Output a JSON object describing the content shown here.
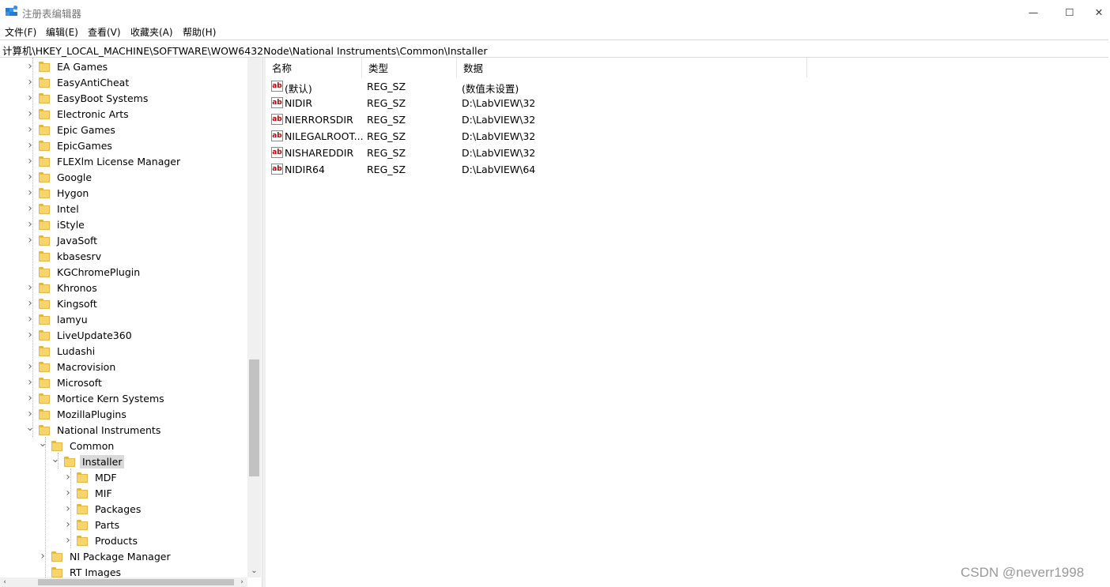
{
  "window": {
    "title": "注册表编辑器",
    "minimize_glyph": "—",
    "maximize_glyph": "☐",
    "close_glyph": "✕"
  },
  "menu": [
    "文件(F)",
    "编辑(E)",
    "查看(V)",
    "收藏夹(A)",
    "帮助(H)"
  ],
  "address": "计算机\\HKEY_LOCAL_MACHINE\\SOFTWARE\\WOW6432Node\\National Instruments\\Common\\Installer",
  "tree": {
    "items": [
      {
        "label": "EA Games",
        "expander": "collapsed"
      },
      {
        "label": "EasyAntiCheat",
        "expander": "collapsed"
      },
      {
        "label": "EasyBoot Systems",
        "expander": "collapsed"
      },
      {
        "label": "Electronic Arts",
        "expander": "collapsed"
      },
      {
        "label": "Epic Games",
        "expander": "collapsed"
      },
      {
        "label": "EpicGames",
        "expander": "collapsed"
      },
      {
        "label": "FLEXlm License Manager",
        "expander": "collapsed"
      },
      {
        "label": "Google",
        "expander": "collapsed"
      },
      {
        "label": "Hygon",
        "expander": "collapsed"
      },
      {
        "label": "Intel",
        "expander": "collapsed"
      },
      {
        "label": "iStyle",
        "expander": "collapsed"
      },
      {
        "label": "JavaSoft",
        "expander": "collapsed"
      },
      {
        "label": "kbasesrv",
        "expander": "none"
      },
      {
        "label": "KGChromePlugin",
        "expander": "none"
      },
      {
        "label": "Khronos",
        "expander": "collapsed"
      },
      {
        "label": "Kingsoft",
        "expander": "collapsed"
      },
      {
        "label": "lamyu",
        "expander": "collapsed"
      },
      {
        "label": "LiveUpdate360",
        "expander": "collapsed"
      },
      {
        "label": "Ludashi",
        "expander": "none"
      },
      {
        "label": "Macrovision",
        "expander": "collapsed"
      },
      {
        "label": "Microsoft",
        "expander": "collapsed"
      },
      {
        "label": "Mortice Kern Systems",
        "expander": "collapsed"
      },
      {
        "label": "MozillaPlugins",
        "expander": "collapsed"
      },
      {
        "label": "National Instruments",
        "expander": "expanded"
      },
      {
        "label": "Common",
        "expander": "expanded"
      },
      {
        "label": "Installer",
        "expander": "expanded",
        "selected": true
      },
      {
        "label": "MDF",
        "expander": "collapsed"
      },
      {
        "label": "MIF",
        "expander": "collapsed"
      },
      {
        "label": "Packages",
        "expander": "collapsed"
      },
      {
        "label": "Parts",
        "expander": "collapsed"
      },
      {
        "label": "Products",
        "expander": "collapsed"
      },
      {
        "label": "NI Package Manager",
        "expander": "collapsed"
      },
      {
        "label": "RT Images",
        "expander": "none"
      }
    ]
  },
  "columns": {
    "name": "名称",
    "type": "类型",
    "data": "数据"
  },
  "values": [
    {
      "icon": "ab",
      "name": "(默认)",
      "type": "REG_SZ",
      "data": "(数值未设置)"
    },
    {
      "icon": "ab",
      "name": "NIDIR",
      "type": "REG_SZ",
      "data": "D:\\LabVIEW\\32"
    },
    {
      "icon": "ab",
      "name": "NIERRORSDIR",
      "type": "REG_SZ",
      "data": "D:\\LabVIEW\\32"
    },
    {
      "icon": "ab",
      "name": "NILEGALROOT...",
      "type": "REG_SZ",
      "data": "D:\\LabVIEW\\32"
    },
    {
      "icon": "ab",
      "name": "NISHAREDDIR",
      "type": "REG_SZ",
      "data": "D:\\LabVIEW\\32"
    },
    {
      "icon": "ab",
      "name": "NIDIR64",
      "type": "REG_SZ",
      "data": "D:\\LabVIEW\\64"
    }
  ],
  "watermark": "CSDN @neverr1998"
}
